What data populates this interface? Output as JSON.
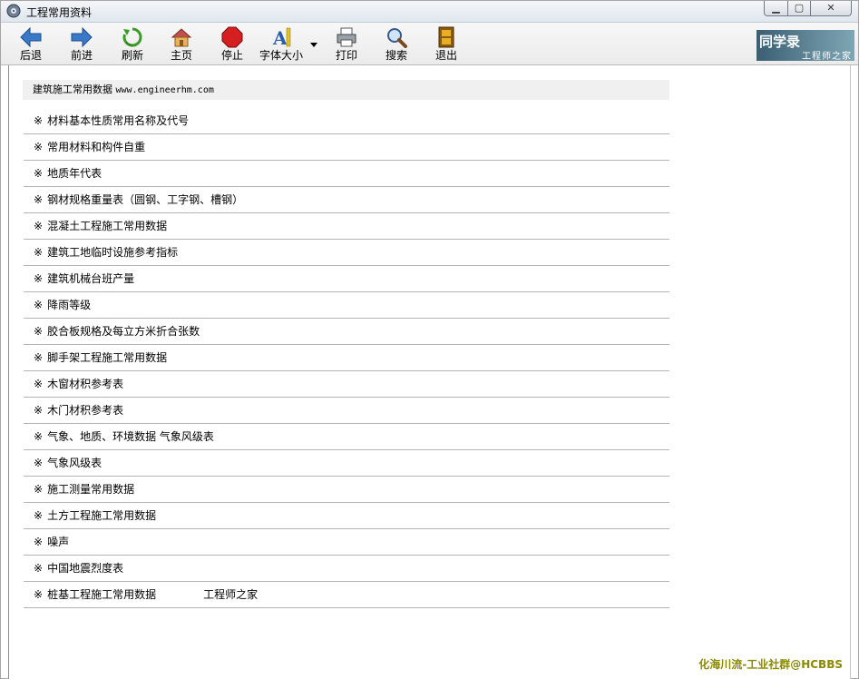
{
  "window": {
    "title": "工程常用资料"
  },
  "toolbar": {
    "back": "后退",
    "forward": "前进",
    "refresh": "刷新",
    "home": "主页",
    "stop": "停止",
    "font_size": "字体大小",
    "print": "打印",
    "search": "搜索",
    "exit": "退出"
  },
  "brand": {
    "main": "同学录",
    "sub": "工程师之家"
  },
  "content": {
    "header_title": "建筑施工常用数据",
    "header_url": "www.engineerhm.com",
    "bullet": "※",
    "items": [
      {
        "label": "材料基本性质常用名称及代号"
      },
      {
        "label": "常用材料和构件自重"
      },
      {
        "label": "地质年代表"
      },
      {
        "label": "钢材规格重量表（圆钢、工字钢、槽钢）"
      },
      {
        "label": "混凝土工程施工常用数据"
      },
      {
        "label": "建筑工地临时设施参考指标"
      },
      {
        "label": "建筑机械台班产量"
      },
      {
        "label": "降雨等级"
      },
      {
        "label": "胶合板规格及每立方米折合张数"
      },
      {
        "label": "脚手架工程施工常用数据"
      },
      {
        "label": "木窗材积参考表"
      },
      {
        "label": "木门材积参考表"
      },
      {
        "label": "气象、地质、环境数据 气象风级表"
      },
      {
        "label": "气象风级表"
      },
      {
        "label": "施工测量常用数据"
      },
      {
        "label": "土方工程施工常用数据"
      },
      {
        "label": "噪声"
      },
      {
        "label": "中国地震烈度表"
      },
      {
        "label": "桩基工程施工常用数据",
        "extra": "工程师之家"
      }
    ]
  },
  "watermark": "化海川流-工业社群@HCBBS"
}
